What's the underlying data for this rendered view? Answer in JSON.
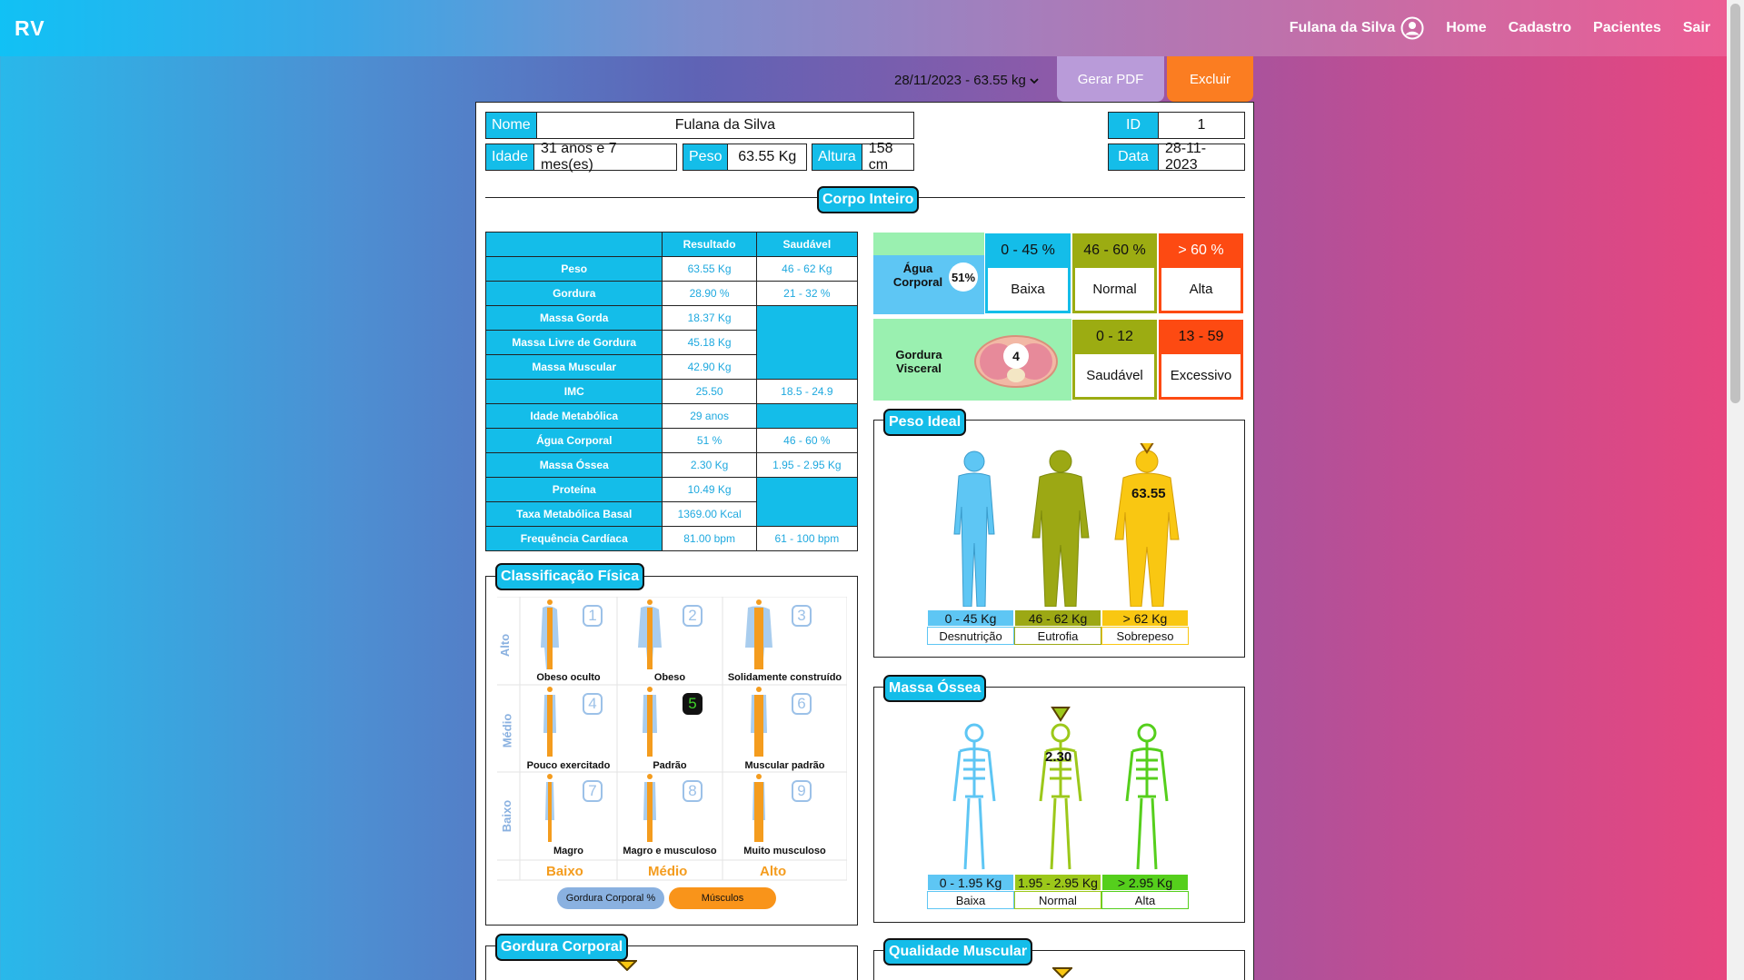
{
  "nav": {
    "brand": "RV",
    "user": "Fulana da Silva",
    "links": [
      "Home",
      "Cadastro",
      "Pacientes",
      "Sair"
    ]
  },
  "toolbar": {
    "date_select": "28/11/2023 - 63.55 kg",
    "pdf_label": "Gerar PDF",
    "delete_label": "Excluir"
  },
  "patient": {
    "nome_label": "Nome",
    "nome": "Fulana da Silva",
    "idade_label": "Idade",
    "idade": "31 anos e 7 mes(es)",
    "peso_label": "Peso",
    "peso": "63.55 Kg",
    "altura_label": "Altura",
    "altura": "158 cm",
    "id_label": "ID",
    "id": "1",
    "data_label": "Data",
    "data": "28-11-2023"
  },
  "section_corpo": "Corpo Inteiro",
  "table": {
    "headers": [
      "",
      "Resultado",
      "Saudável"
    ],
    "rows": [
      {
        "name": "Peso",
        "result": "63.55 Kg",
        "healthy": "46 - 62 Kg"
      },
      {
        "name": "Gordura",
        "result": "28.90 %",
        "healthy": "21 - 32 %"
      },
      {
        "name": "Massa Gorda",
        "result": "18.37 Kg",
        "healthy": ""
      },
      {
        "name": "Massa Livre de Gordura",
        "result": "45.18 Kg",
        "healthy": ""
      },
      {
        "name": "Massa Muscular",
        "result": "42.90 Kg",
        "healthy": ""
      },
      {
        "name": "IMC",
        "result": "25.50",
        "healthy": "18.5 - 24.9"
      },
      {
        "name": "Idade Metabólica",
        "result": "29 anos",
        "healthy": ""
      },
      {
        "name": "Água Corporal",
        "result": "51 %",
        "healthy": "46 - 60 %"
      },
      {
        "name": "Massa Óssea",
        "result": "2.30 Kg",
        "healthy": "1.95 - 2.95 Kg"
      },
      {
        "name": "Proteína",
        "result": "10.49 Kg",
        "healthy": ""
      },
      {
        "name": "Taxa Metabólica Basal",
        "result": "1369.00 Kcal",
        "healthy": ""
      },
      {
        "name": "Frequência Cardíaca",
        "result": "81.00 bpm",
        "healthy": "61 - 100 bpm"
      }
    ]
  },
  "water": {
    "label": "Água Corporal",
    "value": "51%",
    "ranges": [
      {
        "range": "0 - 45 %",
        "label": "Baixa",
        "color": "#14bde9"
      },
      {
        "range": "46 - 60 %",
        "label": "Normal",
        "color": "#9cac12"
      },
      {
        "range": "> 60 %",
        "label": "Alta",
        "color": "#fd4a12"
      }
    ]
  },
  "visceral": {
    "label": "Gordura Visceral",
    "value": "4",
    "ranges": [
      {
        "range": "0 - 12",
        "label": "Saudável",
        "color": "#9cac12"
      },
      {
        "range": "13 - 59",
        "label": "Excessivo",
        "color": "#fd4a12"
      }
    ]
  },
  "peso_ideal": {
    "title": "Peso Ideal",
    "value": "63.55",
    "ranges": [
      {
        "range": "0 - 45 Kg",
        "label": "Desnutrição",
        "color": "#5ec6f4"
      },
      {
        "range": "46 - 62 Kg",
        "label": "Eutrofia",
        "color": "#9ca814"
      },
      {
        "range": "> 62 Kg",
        "label": "Sobrepeso",
        "color": "#f9c712"
      }
    ]
  },
  "massa_ossea": {
    "title": "Massa Óssea",
    "value": "2.30",
    "ranges": [
      {
        "range": "0 - 1.95 Kg",
        "label": "Baixa",
        "color": "#5ec6f4"
      },
      {
        "range": "1.95 - 2.95 Kg",
        "label": "Normal",
        "color": "#9cc81a"
      },
      {
        "range": "> 2.95 Kg",
        "label": "Alta",
        "color": "#55cf1c"
      }
    ]
  },
  "classificacao": {
    "title": "Classificação Física",
    "selected": "5",
    "rows": [
      "Alto",
      "Médio",
      "Baixo"
    ],
    "cols": [
      "Baixo",
      "Médio",
      "Alto"
    ],
    "cells": [
      {
        "n": "1",
        "label": "Obeso oculto"
      },
      {
        "n": "2",
        "label": "Obeso"
      },
      {
        "n": "3",
        "label": "Solidamente construído"
      },
      {
        "n": "4",
        "label": "Pouco exercitado"
      },
      {
        "n": "5",
        "label": "Padrão"
      },
      {
        "n": "6",
        "label": "Muscular padrão"
      },
      {
        "n": "7",
        "label": "Magro"
      },
      {
        "n": "8",
        "label": "Magro e musculoso"
      },
      {
        "n": "9",
        "label": "Muito musculoso"
      }
    ],
    "legend_fat": "Gordura Corporal %",
    "legend_muscle": "Músculos"
  },
  "gordura_corporal_title": "Gordura Corporal",
  "qualidade_muscular_title": "Qualidade Muscular"
}
